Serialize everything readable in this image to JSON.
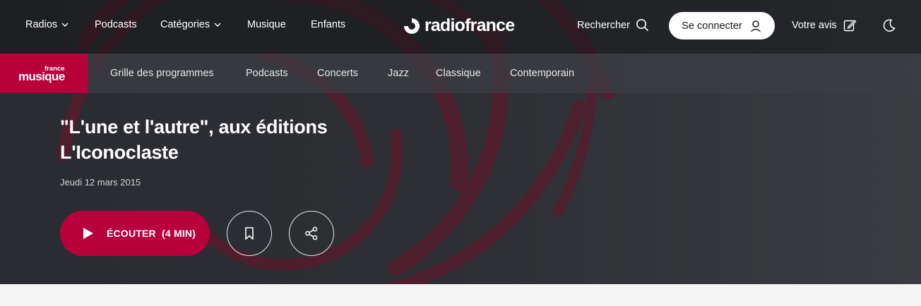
{
  "header": {
    "nav": [
      {
        "label": "Radios",
        "has_dropdown": true
      },
      {
        "label": "Podcasts",
        "has_dropdown": false
      },
      {
        "label": "Catégories",
        "has_dropdown": true
      },
      {
        "label": "Musique",
        "has_dropdown": false
      },
      {
        "label": "Enfants",
        "has_dropdown": false
      }
    ],
    "logo_text": "radiofrance",
    "search_label": "Rechercher",
    "connect_label": "Se connecter",
    "feedback_label": "Votre avis",
    "theme_icon": "moon-icon"
  },
  "station": {
    "logo_small": "france",
    "logo_big": "musique",
    "brand_color": "#b8003d",
    "menu": [
      "Grille des programmes",
      "Podcasts",
      "Concerts",
      "Jazz",
      "Classique",
      "Contemporain"
    ]
  },
  "episode": {
    "title_line1": "\"L'une et l'autre\", aux éditions",
    "title_line2": "L'Iconoclaste",
    "date": "Jeudi 12 mars 2015",
    "listen_label": "ÉCOUTER",
    "duration": "(4 MIN)"
  }
}
